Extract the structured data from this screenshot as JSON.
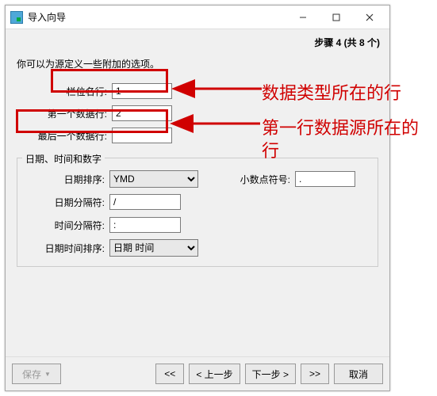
{
  "window": {
    "title": "导入向导",
    "step_label": "步骤 4 (共 8 个)"
  },
  "desc": "你可以为源定义一些附加的选项。",
  "rows": {
    "field_name_row_label": "栏位名行:",
    "field_name_row_value": "1",
    "first_data_row_label": "第一个数据行:",
    "first_data_row_value": "2",
    "last_data_row_label": "最后一个数据行:",
    "last_data_row_value": ""
  },
  "fieldset": {
    "legend": "日期、时间和数字",
    "date_order_label": "日期排序:",
    "date_order_value": "YMD",
    "date_sep_label": "日期分隔符:",
    "date_sep_value": "/",
    "time_sep_label": "时间分隔符:",
    "time_sep_value": ":",
    "datetime_order_label": "日期时间排序:",
    "datetime_order_value": "日期 时间",
    "decimal_label": "小数点符号:",
    "decimal_value": "."
  },
  "buttons": {
    "save": "保存",
    "first": "<<",
    "prev": "< 上一步",
    "next": "下一步 >",
    "last": ">>",
    "cancel": "取消"
  },
  "annotations": {
    "an1": "数据类型所在的行",
    "an2": "第一行数据源所在的行"
  }
}
